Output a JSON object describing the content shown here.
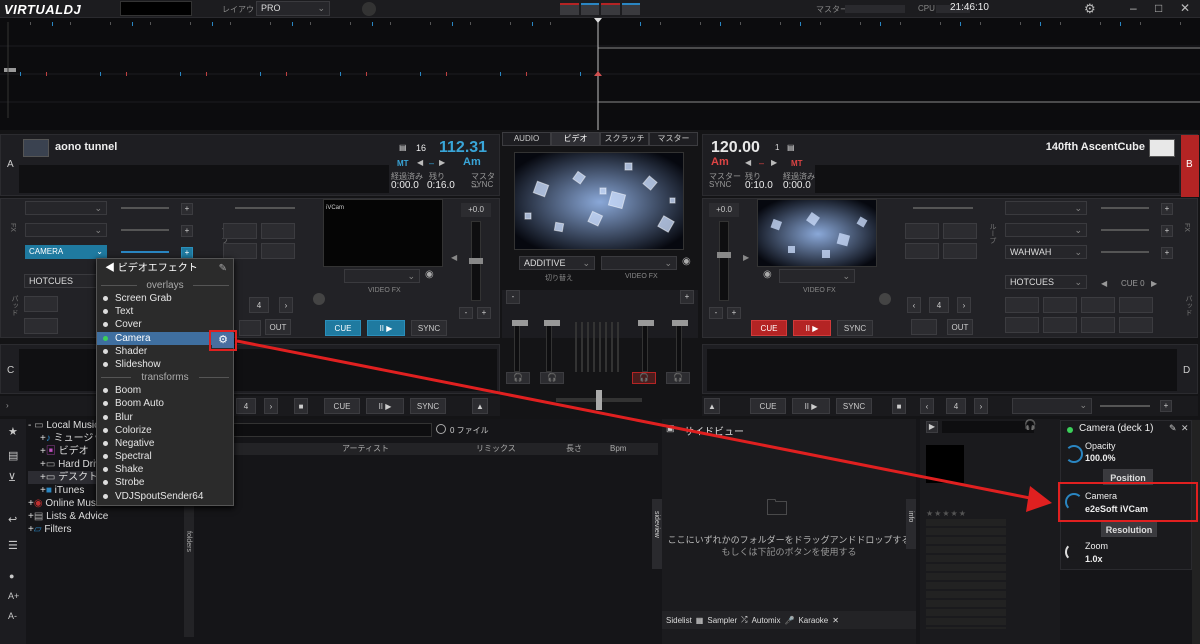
{
  "app": {
    "logo": "VIRTUALDJ",
    "layout_label": "レイアウト",
    "layout_value": "PRO",
    "master_label": "マスター",
    "cpu_label": "CPU",
    "time": "21:46:10"
  },
  "deck_left": {
    "letter": "A",
    "title": "aono tunnel",
    "beat": "16",
    "bpm": "112.31",
    "mt": "MT",
    "key": "Am",
    "elapsed_label": "経過済み",
    "elapsed": "0:00.0",
    "remain_label": "残り",
    "remain": "0:16.0",
    "master_label": "マスター",
    "master_value": "SYNC",
    "cue": "CUE",
    "play": "II ▶",
    "sync": "SYNC",
    "out": "OUT",
    "loop": "4",
    "hotcues": "HOTCUES",
    "camera_field": "CAMERA",
    "video_fx_label": "VIDEO FX",
    "video_label": "iVCam",
    "pitch": "+0.0"
  },
  "deck_right": {
    "letter": "B",
    "title": "140fth AscentCube",
    "bpm": "120.00",
    "beat": "1",
    "key": "Am",
    "mt": "MT",
    "sync_label": "マスター",
    "sync_value": "SYNC",
    "elapsed_label": "経過済み",
    "elapsed": "0:10.0",
    "remain_label": "残り",
    "remain": "0:00.0",
    "cue": "CUE",
    "play": "II ▶",
    "sync": "SYNC",
    "out": "OUT",
    "loop": "4",
    "hotcues": "HOTCUES",
    "cue0": "CUE 0",
    "wahwah": "WAHWAH",
    "video_fx_label": "VIDEO FX",
    "pitch": "+0.0"
  },
  "center": {
    "tabs": [
      "AUDIO",
      "ビデオ",
      "スクラッチ",
      "マスター"
    ],
    "mix_mode": "ADDITIVE",
    "mix_label": "切り替え",
    "video_fx_label": "VIDEO FX"
  },
  "deck_c": {
    "letter": "C",
    "cue": "CUE",
    "play": "II ▶",
    "sync": "SYNC",
    "loop": "4"
  },
  "deck_d": {
    "letter": "D",
    "cue": "CUE",
    "play": "II ▶",
    "sync": "SYNC",
    "loop": "4"
  },
  "side_labels": {
    "fx": "FX",
    "pad": "パッド",
    "loop": "ループ"
  },
  "effect_menu": {
    "title": "ビデオエフェクト",
    "groups": [
      {
        "header": "overlays",
        "items": [
          "Screen Grab",
          "Text",
          "Cover",
          "Camera",
          "Shader",
          "Slideshow"
        ]
      },
      {
        "header": "transforms",
        "items": [
          "Boom",
          "Boom Auto",
          "Blur",
          "Colorize",
          "Negative",
          "Spectral",
          "Shake",
          "Strobe",
          "VDJSpoutSender64"
        ]
      }
    ],
    "selected": "Camera"
  },
  "browser": {
    "tree": [
      "Local Music",
      "ミュージック",
      "ビデオ",
      "Hard Drives",
      "デスクトップ",
      "iTunes",
      "Online Music",
      "Lists & Advice",
      "Filters"
    ],
    "file_count": "0 ファイル",
    "columns": [
      "アーティスト",
      "リミックス",
      "長さ",
      "Bpm"
    ],
    "folders_tab": "folders",
    "sideview_tab": "sideview",
    "info_tab": "info",
    "sideview_title": "サイドビュー",
    "drop_line1": "ここにいずれかのフォルダーをドラッグアンドドロップする",
    "drop_line2": "もしくは下記のボタンを使用する",
    "bottom_tabs": [
      "Sidelist",
      "Sampler",
      "Automix",
      "Karaoke"
    ]
  },
  "fx_panel": {
    "title": "Camera (deck 1)",
    "opacity_label": "Opacity",
    "opacity_value": "100.0%",
    "position_button": "Position",
    "camera_label": "Camera",
    "camera_value": "e2eSoft iVCam",
    "resolution_button": "Resolution",
    "zoom_label": "Zoom",
    "zoom_value": "1.0x"
  },
  "colors": {
    "accent_blue": "#39a5d8",
    "accent_red": "#b42424",
    "highlight": "#e02020"
  }
}
